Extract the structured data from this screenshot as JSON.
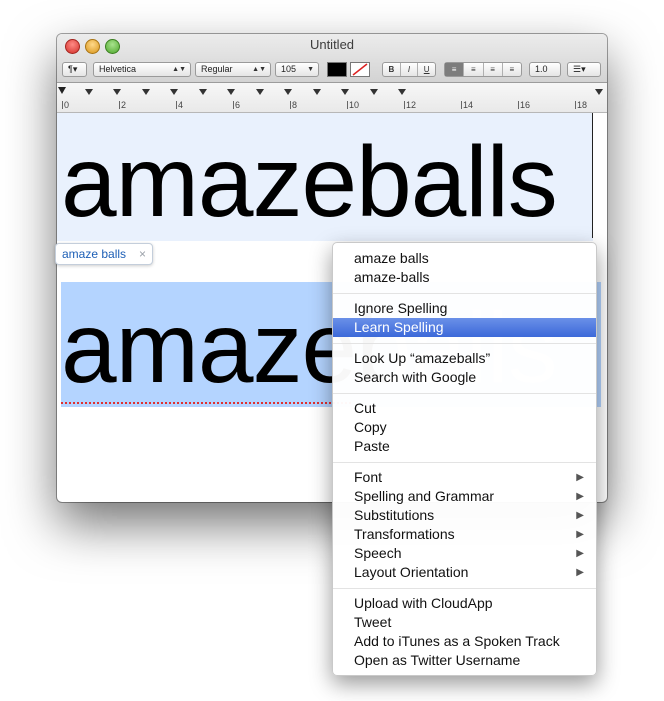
{
  "window": {
    "title": "Untitled"
  },
  "toolbar": {
    "paragraph_style": "¶▾",
    "font_family": "Helvetica",
    "font_style": "Regular",
    "font_size": "105",
    "bold": "B",
    "italic": "I",
    "underline": "U",
    "line_spacing": "1.0",
    "list_style": "☰▾",
    "text_color": "#000000"
  },
  "ruler": {
    "numbers": [
      "0",
      "2",
      "4",
      "6",
      "8",
      "10",
      "12",
      "14",
      "16",
      "18"
    ]
  },
  "document": {
    "line1": "amazeballs",
    "line2": "amazeballs"
  },
  "autocorrect": {
    "suggestion": "amaze balls",
    "dismiss": "×"
  },
  "context_menu": {
    "groups": [
      [
        "amaze balls",
        "amaze-balls"
      ],
      [
        "Ignore Spelling",
        "Learn Spelling"
      ],
      [
        "Look Up “amazeballs”",
        "Search with Google"
      ],
      [
        "Cut",
        "Copy",
        "Paste"
      ],
      [
        "Font",
        "Spelling and Grammar",
        "Substitutions",
        "Transformations",
        "Speech",
        "Layout Orientation"
      ],
      [
        "Upload with CloudApp",
        "Tweet",
        "Add to iTunes as a Spoken Track",
        "Open as Twitter Username"
      ]
    ],
    "highlighted": "Learn Spelling",
    "submenu_arrow": "▶"
  },
  "colors": {
    "highlight": "#3c69d9",
    "selection": "#b4d4ff",
    "autocorrect_text": "#1d5fb6"
  }
}
